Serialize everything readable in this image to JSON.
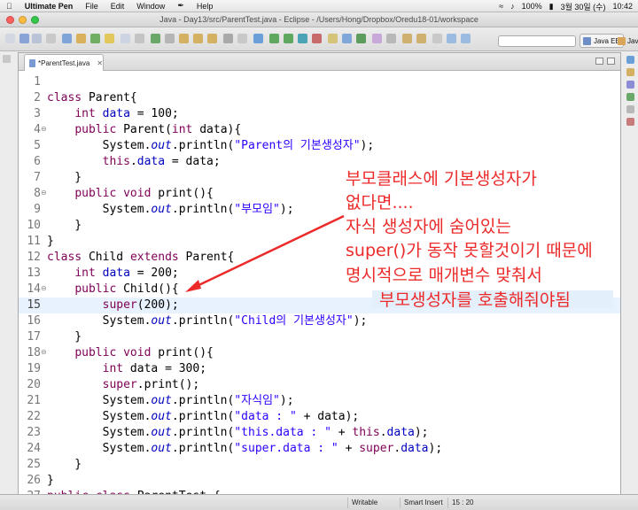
{
  "menubar": {
    "apple": "",
    "app_name": "Ultimate Pen",
    "items": [
      "File",
      "Edit",
      "Window",
      "Help"
    ],
    "battery": "100%",
    "date": "3월 30일 (수)",
    "time": "10:42"
  },
  "window": {
    "title": "Java - Day13/src/ParentTest.java - Eclipse - /Users/Hong/Dropbox/Oredu18-01/workspace"
  },
  "perspectives": {
    "java_ee": "Java EE",
    "java": "Java"
  },
  "editor": {
    "tab_label": "*ParentTest.java",
    "current_line": 15
  },
  "code_lines": [
    {
      "num": "1",
      "fold": ""
    },
    {
      "num": "2",
      "fold": ""
    },
    {
      "num": "3",
      "fold": ""
    },
    {
      "num": "4",
      "fold": "⊖"
    },
    {
      "num": "5",
      "fold": ""
    },
    {
      "num": "6",
      "fold": ""
    },
    {
      "num": "7",
      "fold": ""
    },
    {
      "num": "8",
      "fold": "⊖"
    },
    {
      "num": "9",
      "fold": ""
    },
    {
      "num": "10",
      "fold": ""
    },
    {
      "num": "11",
      "fold": ""
    },
    {
      "num": "12",
      "fold": ""
    },
    {
      "num": "13",
      "fold": ""
    },
    {
      "num": "14",
      "fold": "⊖"
    },
    {
      "num": "15",
      "fold": ""
    },
    {
      "num": "16",
      "fold": ""
    },
    {
      "num": "17",
      "fold": ""
    },
    {
      "num": "18",
      "fold": "⊖"
    },
    {
      "num": "19",
      "fold": ""
    },
    {
      "num": "20",
      "fold": ""
    },
    {
      "num": "21",
      "fold": ""
    },
    {
      "num": "22",
      "fold": ""
    },
    {
      "num": "23",
      "fold": ""
    },
    {
      "num": "24",
      "fold": ""
    },
    {
      "num": "25",
      "fold": ""
    },
    {
      "num": "26",
      "fold": ""
    },
    {
      "num": "27",
      "fold": ""
    }
  ],
  "code_tokens": {
    "l2": [
      "class",
      " Parent{"
    ],
    "l3": [
      "    ",
      "int",
      " ",
      "data",
      " = 100;"
    ],
    "l4": [
      "    ",
      "public",
      " Parent(",
      "int",
      " data){"
    ],
    "l5": [
      "        System.",
      "out",
      ".println(",
      "\"Parent의 기본생성자\"",
      ");"
    ],
    "l6": [
      "        ",
      "this",
      ".",
      "data",
      " = data;"
    ],
    "l7": [
      "    }"
    ],
    "l8": [
      "    ",
      "public",
      " ",
      "void",
      " print(){"
    ],
    "l9": [
      "        System.",
      "out",
      ".println(",
      "\"부모임\"",
      ");"
    ],
    "l10": [
      "    }"
    ],
    "l11": [
      "}"
    ],
    "l12": [
      "class",
      " Child ",
      "extends",
      " Parent{"
    ],
    "l13": [
      "    ",
      "int",
      " ",
      "data",
      " = 200;"
    ],
    "l14": [
      "    ",
      "public",
      " Child(){"
    ],
    "l15": [
      "        ",
      "super",
      "(200);"
    ],
    "l16": [
      "        System.",
      "out",
      ".println(",
      "\"Child의 기본생성자\"",
      ");"
    ],
    "l17": [
      "    }"
    ],
    "l18": [
      "    ",
      "public",
      " ",
      "void",
      " print(){"
    ],
    "l19": [
      "        ",
      "int",
      " data = 300;"
    ],
    "l20": [
      "        ",
      "super",
      ".print();"
    ],
    "l21": [
      "        System.",
      "out",
      ".println(",
      "\"자식임\"",
      ");"
    ],
    "l22": [
      "        System.",
      "out",
      ".println(",
      "\"data : \"",
      " + data);"
    ],
    "l23": [
      "        System.",
      "out",
      ".println(",
      "\"this.data : \"",
      " + ",
      "this",
      ".",
      "data",
      ");"
    ],
    "l24": [
      "        System.",
      "out",
      ".println(",
      "\"super.data : \"",
      " + ",
      "super",
      ".",
      "data",
      ");"
    ],
    "l25": [
      "    }"
    ],
    "l26": [
      "}"
    ],
    "l27": [
      "public",
      " ",
      "class",
      " ParentTest {"
    ]
  },
  "annotation": {
    "lines": [
      "부모클래스에 기본생성자가",
      "없다면....",
      "자식 생성자에 숨어있는",
      "super()가 동작 못할것이기 때문에",
      "명시적으로 매개변수 맞춰서",
      "부모생성자를 호출해줘야됨"
    ],
    "color": "#ec2a2a"
  },
  "status": {
    "writable": "Writable",
    "insert_mode": "Smart Insert",
    "position": "15 : 20"
  },
  "colors": {
    "keyword": "#7f0055",
    "field": "#0000c0",
    "string": "#2a00ff",
    "current_line": "#e8f2fe"
  }
}
